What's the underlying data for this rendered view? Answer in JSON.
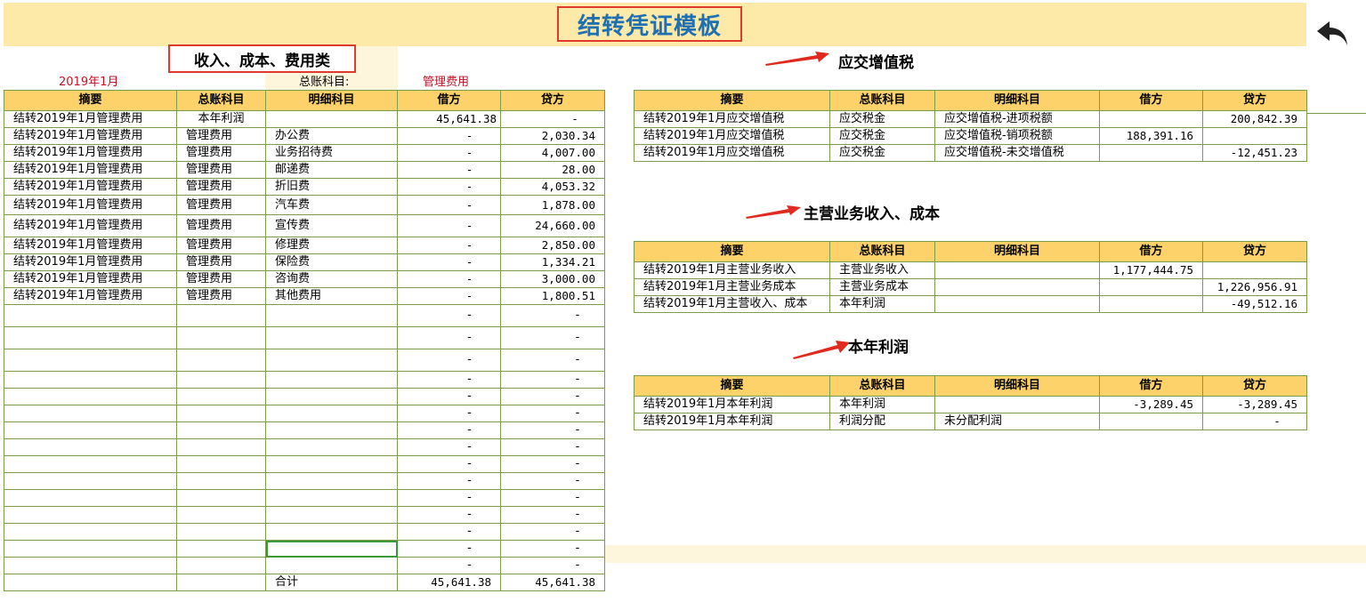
{
  "title": "结转凭证模板",
  "category_label": "收入、成本、费用类",
  "period": "2019年1月",
  "account_label": "总账科目:",
  "account_value": "管理费用",
  "headers": [
    "摘要",
    "总账科目",
    "明细科目",
    "借方",
    "贷方"
  ],
  "main_rows": [
    [
      "结转2019年1月管理费用",
      "本年利润",
      "",
      "45,641.38",
      "-"
    ],
    [
      "结转2019年1月管理费用",
      "管理费用",
      "办公费",
      "-",
      "2,030.34"
    ],
    [
      "结转2019年1月管理费用",
      "管理费用",
      "业务招待费",
      "-",
      "4,007.00"
    ],
    [
      "结转2019年1月管理费用",
      "管理费用",
      "邮递费",
      "-",
      "28.00"
    ],
    [
      "结转2019年1月管理费用",
      "管理费用",
      "折旧费",
      "-",
      "4,053.32"
    ],
    [
      "结转2019年1月管理费用",
      "管理费用",
      "汽车费",
      "-",
      "1,878.00"
    ],
    [
      "结转2019年1月管理费用",
      "管理费用",
      "宣传费",
      "-",
      "24,660.00"
    ],
    [
      "结转2019年1月管理费用",
      "管理费用",
      "修理费",
      "-",
      "2,850.00"
    ],
    [
      "结转2019年1月管理费用",
      "管理费用",
      "保险费",
      "-",
      "1,334.21"
    ],
    [
      "结转2019年1月管理费用",
      "管理费用",
      "咨询费",
      "-",
      "3,000.00"
    ],
    [
      "结转2019年1月管理费用",
      "管理费用",
      "其他费用",
      "-",
      "1,800.51"
    ]
  ],
  "empty_dash": "-",
  "total": {
    "label": "合计",
    "debit": "45,641.38",
    "credit": "45,641.38"
  },
  "vat": {
    "heading": "应交增值税",
    "rows": [
      [
        "结转2019年1月应交增值税",
        "应交税金",
        "应交增值税-进项税额",
        "",
        "200,842.39"
      ],
      [
        "结转2019年1月应交增值税",
        "应交税金",
        "应交增值税-销项税额",
        "188,391.16",
        ""
      ],
      [
        "结转2019年1月应交增值税",
        "应交税金",
        "应交增值税-未交增值税",
        "",
        "-12,451.23"
      ]
    ]
  },
  "revenue": {
    "heading": "主营业务收入、成本",
    "rows": [
      [
        "结转2019年1月主营业务收入",
        "主营业务收入",
        "",
        "1,177,444.75",
        ""
      ],
      [
        "结转2019年1月主营业务成本",
        "主营业务成本",
        "",
        "",
        "1,226,956.91"
      ],
      [
        "结转2019年1月主营收入、成本",
        "本年利润",
        "",
        "",
        "-49,512.16"
      ]
    ]
  },
  "profit": {
    "heading": "本年利润",
    "rows": [
      [
        "结转2019年1月本年利润",
        "本年利润",
        "",
        "-3,289.45",
        "-3,289.45"
      ],
      [
        "结转2019年1月本年利润",
        "利润分配",
        "未分配利润",
        "",
        "-"
      ]
    ]
  },
  "icons": {
    "back": "undo-arrow-icon",
    "pointer": "red-arrow-icon"
  },
  "colors": {
    "header_fill": "#fdd26a",
    "band": "#fde9a8",
    "title_text": "#1f6fb3",
    "accent_red": "#e03a2f"
  }
}
